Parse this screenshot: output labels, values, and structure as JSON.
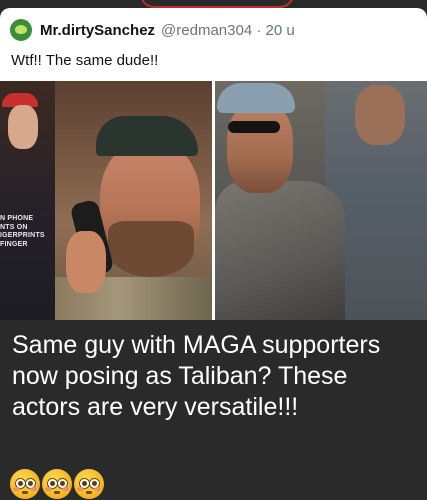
{
  "tweet": {
    "display_name": "Mr.dirtySanchez",
    "handle": "@redman304",
    "separator": "·",
    "time": "20 u",
    "text": "Wtf!! The same dude!!",
    "avatar_icon": "frog-avatar-icon",
    "left_photo_text": "N PHONE\nNTS ON\nIGERPRINTS\nFINGER"
  },
  "caption": {
    "text": "Same guy with MAGA supporters now posing as Taliban? These actors are very versatile!!!",
    "emojis": [
      "flushed-face-icon",
      "flushed-face-icon",
      "flushed-face-icon"
    ]
  },
  "colors": {
    "background": "#2a2a2a",
    "card": "#ffffff",
    "name_text": "#0f1419",
    "handle_text": "#66757f",
    "caption_text": "#ffffff"
  }
}
